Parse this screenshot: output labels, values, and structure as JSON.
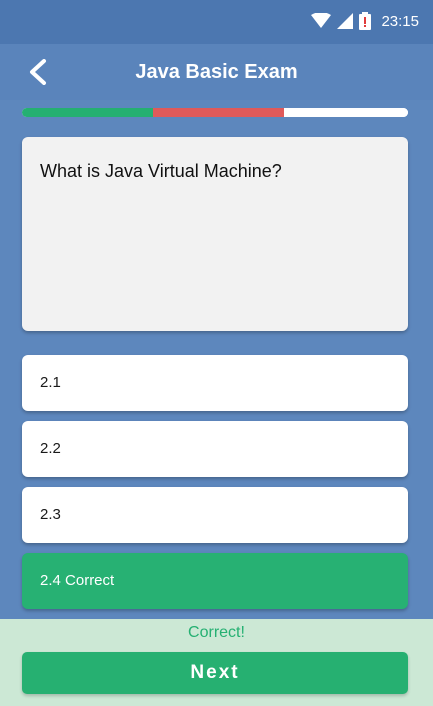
{
  "status_bar": {
    "time": "23:15",
    "icons": [
      "wifi-icon",
      "signal-icon",
      "battery-alert-icon"
    ]
  },
  "app_bar": {
    "title": "Java Basic Exam",
    "back_icon": "chevron-left-icon"
  },
  "progress": {
    "correct_fraction": 0.34,
    "wrong_fraction": 0.34,
    "remaining_fraction": 0.32,
    "colors": {
      "correct": "#25b072",
      "wrong": "#e05a5a",
      "remaining": "#ffffff"
    }
  },
  "question": {
    "text": "What is Java Virtual Machine?"
  },
  "answers": [
    {
      "label": "2.1",
      "state": "default"
    },
    {
      "label": "2.2",
      "state": "default"
    },
    {
      "label": "2.3",
      "state": "default"
    },
    {
      "label": "2.4 Correct",
      "state": "correct"
    }
  ],
  "footer": {
    "feedback": "Correct!",
    "next_label": "Next"
  },
  "colors": {
    "primary": "#5a84bb",
    "status_bar": "#4c77b0",
    "success": "#26b071",
    "footer_bg": "#cce8d5"
  }
}
